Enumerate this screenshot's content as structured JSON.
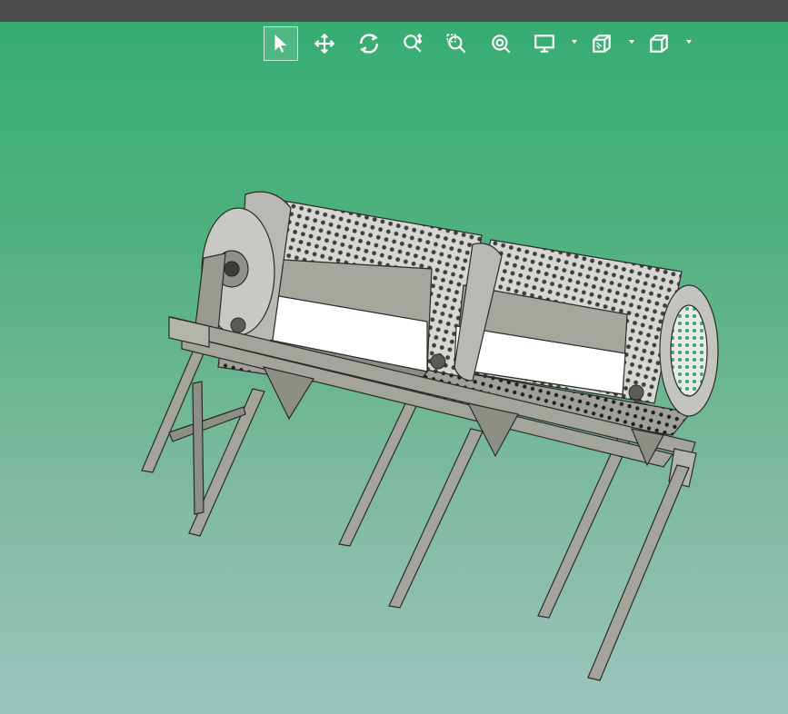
{
  "window": {
    "titlebar_color": "#4b4b4b"
  },
  "viewport": {
    "background_top": "#36ad72",
    "background_bottom": "#9cc4bc",
    "model_name": "",
    "toolbar": {
      "icon_color": "#ffffff",
      "tools": [
        {
          "id": "select",
          "icon": "arrow-pointer-icon",
          "active": true
        },
        {
          "id": "pan",
          "icon": "move-arrows-icon",
          "active": false
        },
        {
          "id": "rotate",
          "icon": "rotate-icon",
          "active": false
        },
        {
          "id": "zoom",
          "icon": "zoom-updown-icon",
          "active": false
        },
        {
          "id": "zoom-window",
          "icon": "zoom-window-icon",
          "active": false
        },
        {
          "id": "zoom-fit",
          "icon": "zoom-fit-icon",
          "active": false
        },
        {
          "id": "display-mode",
          "icon": "monitor-icon",
          "has_dropdown": true
        },
        {
          "id": "section-view",
          "icon": "section-cube-icon",
          "has_dropdown": true
        },
        {
          "id": "view-orientation",
          "icon": "cube-icon",
          "has_dropdown": true
        }
      ]
    }
  }
}
